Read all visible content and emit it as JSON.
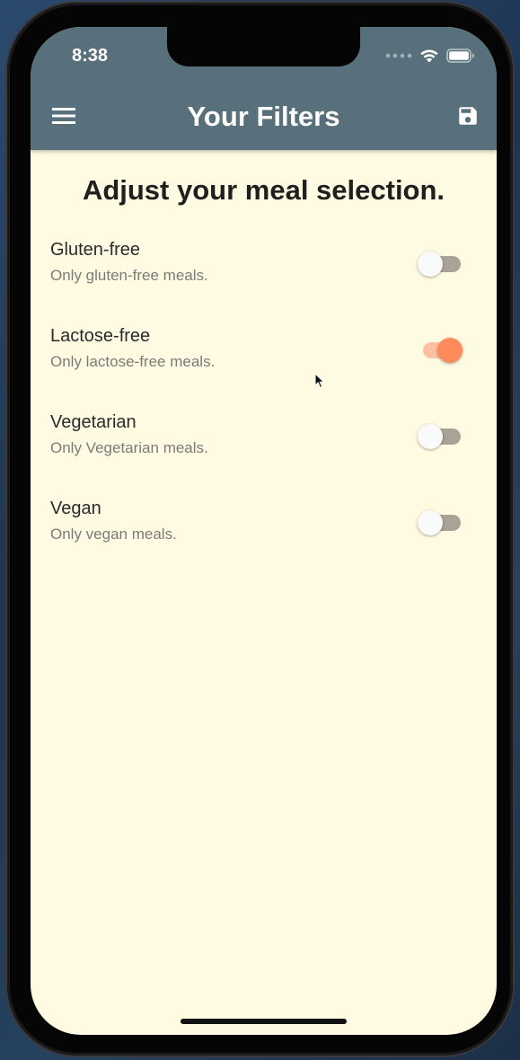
{
  "status_bar": {
    "time": "8:38",
    "icons": [
      "signal-dots-icon",
      "wifi-icon",
      "battery-icon"
    ]
  },
  "app_bar": {
    "title": "Your Filters",
    "left_icon": "menu-icon",
    "right_icon": "save-icon",
    "color": "#586f7c"
  },
  "main": {
    "heading": "Adjust your meal selection.",
    "filters": [
      {
        "title": "Gluten-free",
        "subtitle": "Only gluten-free meals.",
        "enabled": false
      },
      {
        "title": "Lactose-free",
        "subtitle": "Only lactose-free meals.",
        "enabled": true
      },
      {
        "title": "Vegetarian",
        "subtitle": "Only Vegetarian meals.",
        "enabled": false
      },
      {
        "title": "Vegan",
        "subtitle": "Only vegan meals.",
        "enabled": false
      }
    ]
  },
  "colors": {
    "background": "#fffbe3",
    "accent": "#ff8a5c",
    "switch_off_track": "#a7a497"
  }
}
